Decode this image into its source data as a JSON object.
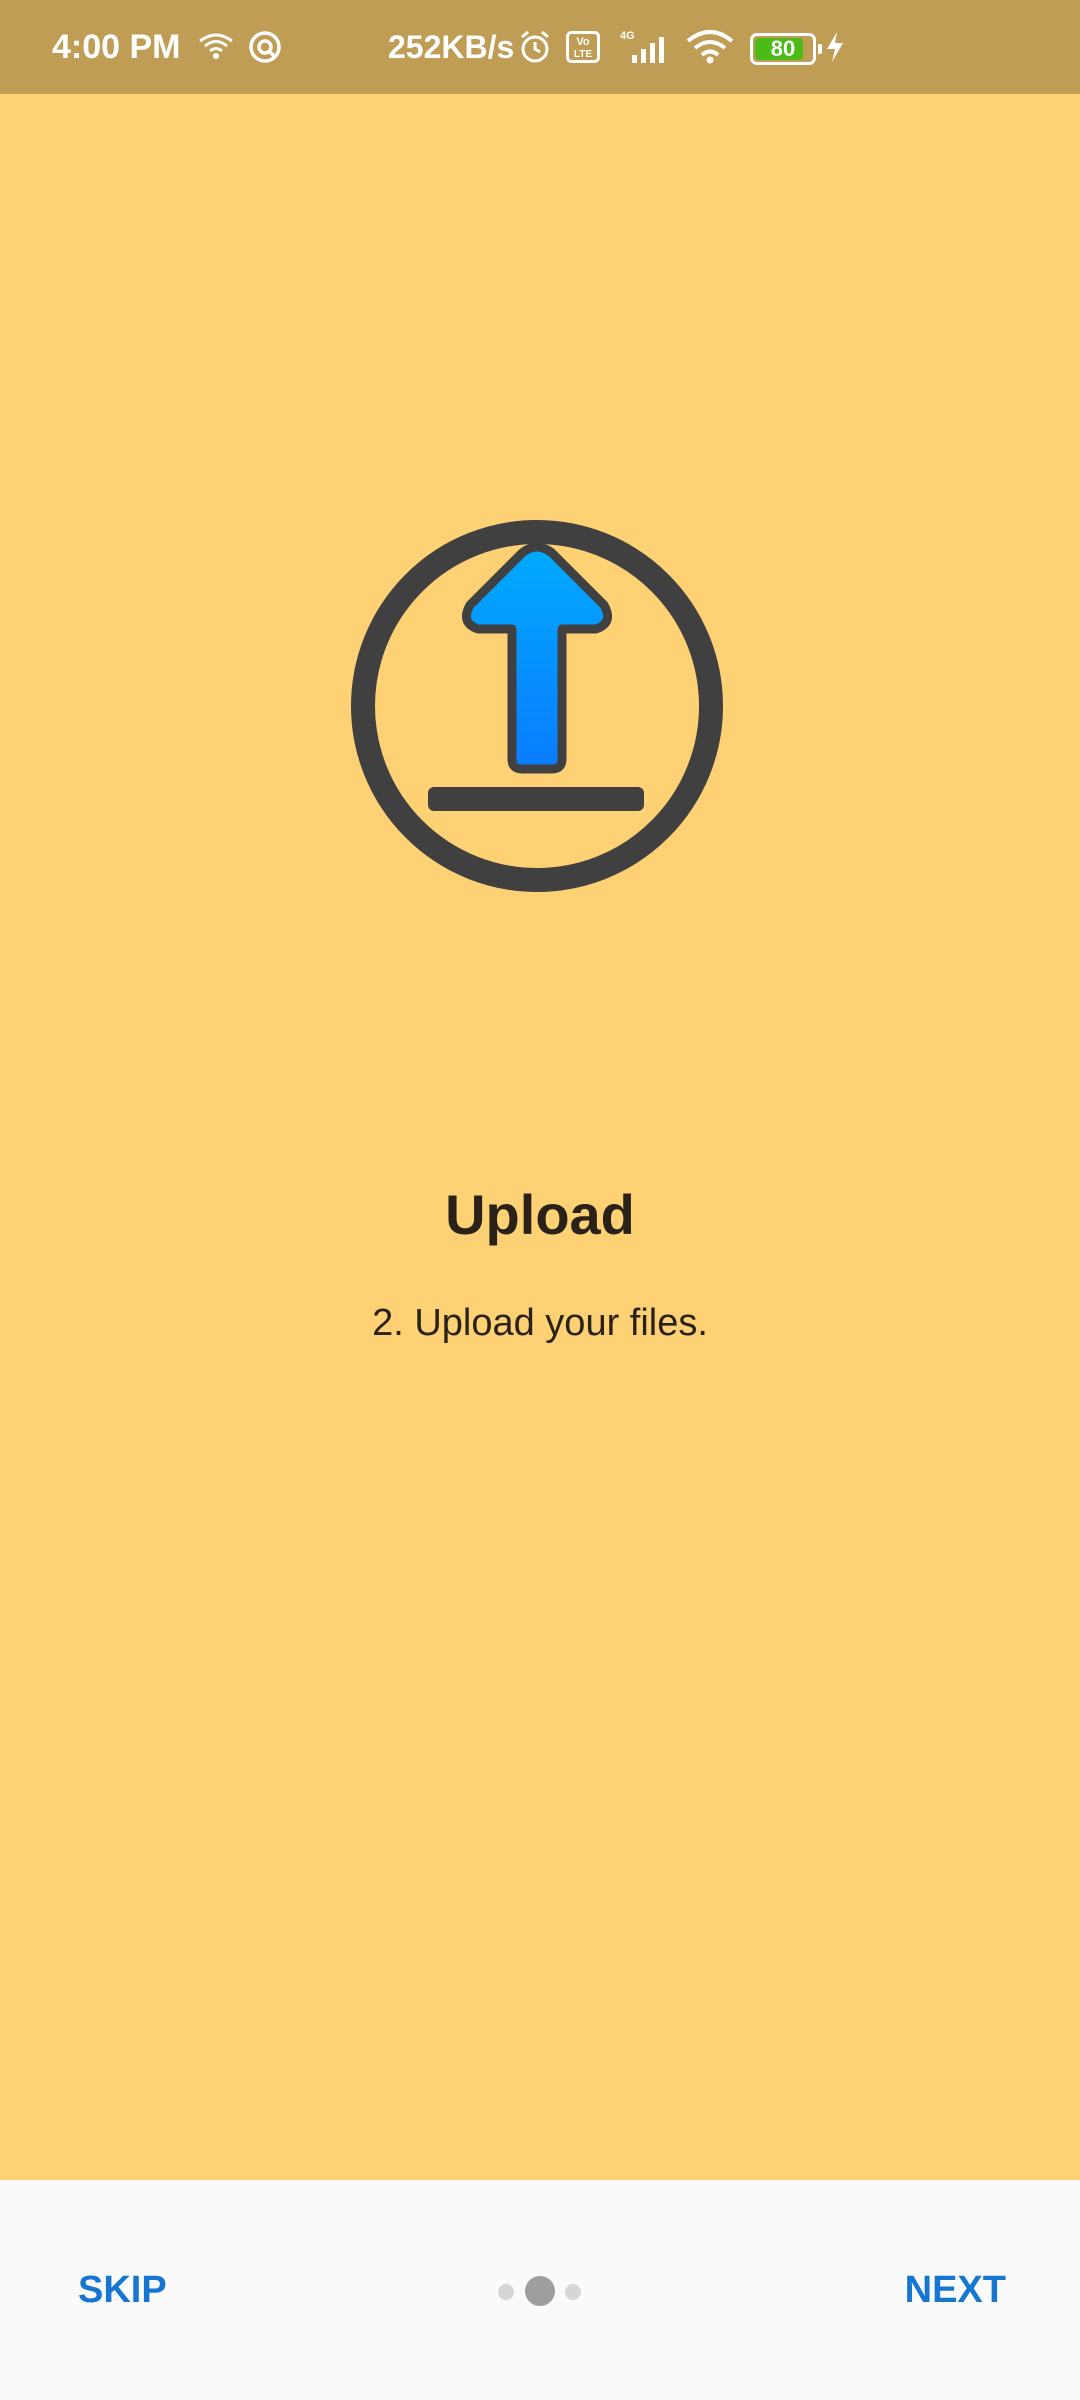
{
  "status_bar": {
    "time": "4:00 PM",
    "network_speed": "252KB/s",
    "network_type": "4G",
    "volte_label": "Vo LTE",
    "battery_level": "80",
    "battery_fraction": 0.8
  },
  "onboarding": {
    "title": "Upload",
    "subtitle": "2. Upload your files.",
    "illustration_icon": "upload-arrow-in-circle-icon",
    "arrow_color": "#0a8cff",
    "circle_color": "#404040"
  },
  "bottom_bar": {
    "skip_label": "SKIP",
    "next_label": "NEXT",
    "page_count": 3,
    "current_page": 2
  },
  "colors": {
    "background": "#fed274",
    "status_bar": "#bf9d55",
    "accent": "#1777d0"
  }
}
